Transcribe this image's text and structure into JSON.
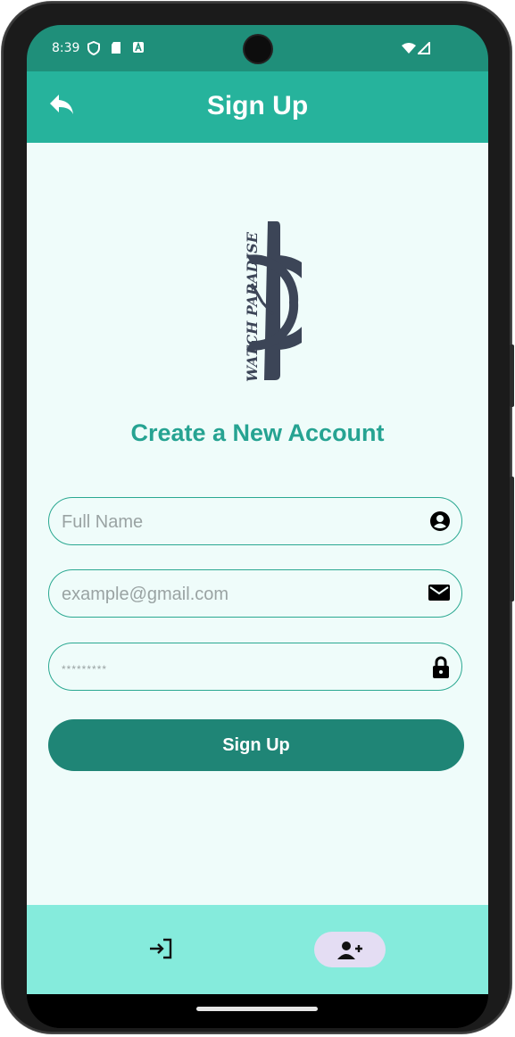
{
  "status_bar": {
    "time": "8:39",
    "left_icons": [
      "shield-icon",
      "sd-card-icon",
      "notification-a-icon"
    ],
    "right_icons": [
      "wifi-icon",
      "signal-icon"
    ]
  },
  "app_bar": {
    "title": "Sign Up",
    "back_icon": "reply-arrow-icon",
    "color": "#26b39c"
  },
  "logo": {
    "text": "WATCH PARADISE",
    "color": "#3c4557"
  },
  "form": {
    "heading": "Create a New Account",
    "fields": [
      {
        "placeholder": "Full Name",
        "value": "",
        "icon": "account-circle-icon"
      },
      {
        "placeholder": "example@gmail.com",
        "value": "",
        "icon": "mail-icon"
      },
      {
        "placeholder": "*********",
        "value": "",
        "icon": "lock-icon"
      }
    ],
    "submit_label": "Sign Up",
    "accent": "#26a392",
    "button_color": "#1f8576"
  },
  "bottom_nav": {
    "items": [
      {
        "icon": "login-icon",
        "selected": false
      },
      {
        "icon": "person-add-icon",
        "selected": true
      }
    ],
    "background": "#85ebdc",
    "selected_indicator": "#e4ddf3"
  }
}
